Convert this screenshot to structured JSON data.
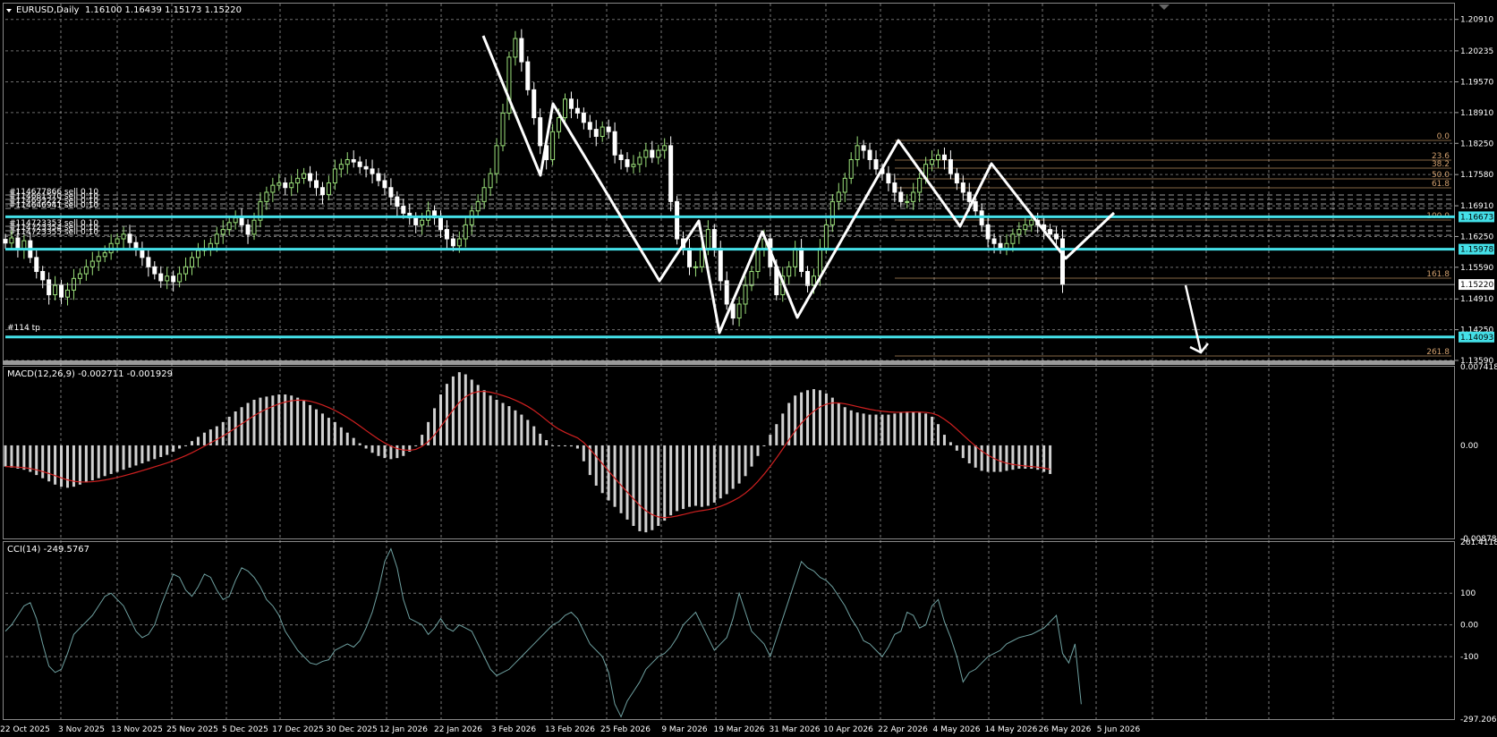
{
  "colors": {
    "background": "#000000",
    "grid": "#c8c8c8",
    "bull_candle": "#9be07a",
    "bear_candle": "#ffffff",
    "cyan_line": "#44e0e8",
    "fib_line": "#d2a06e",
    "macd_hist": "#d0d0d0",
    "macd_signal": "#d02020",
    "cci_line": "#6ea0a0",
    "zigzag": "#ffffff"
  },
  "main_panel": {
    "symbol_label": "EURUSD,Daily",
    "ohlc_label": "1.16100 1.16439 1.15173 1.15220",
    "price_ticks": [
      "1.20910",
      "1.20235",
      "1.19570",
      "1.18910",
      "1.18250",
      "1.17580",
      "1.16910",
      "1.16250",
      "1.15590",
      "1.14910",
      "1.14250",
      "1.13590"
    ],
    "marked_prices": {
      "upper_cyan": "1.16673",
      "middle_cyan": "1.15978",
      "current": "1.15220",
      "lower_cyan": "1.14093"
    },
    "order_labels": [
      "#114677866 sell 0.10",
      "#114681570 sell 0.10",
      "#114693222 sell 0.10",
      "#114646941 sell 0.10",
      "#114723353 sell 0.10",
      "#114723354 sell 0.10",
      "#114723355 sell 0.10"
    ],
    "tp_label": "#114 tp",
    "fib_levels": [
      "0.0",
      "23.6",
      "38.2",
      "50.0",
      "61.8",
      "100.0",
      "161.8",
      "261.8"
    ]
  },
  "macd_panel": {
    "label": "MACD(12,26,9) -0.002711 -0.001929",
    "ticks": [
      "0.007418",
      "0.00",
      "-0.00878"
    ]
  },
  "cci_panel": {
    "label": "CCI(14) -249.5767",
    "ticks": [
      "261.4118",
      "100",
      "0.00",
      "-100",
      "-297.206"
    ]
  },
  "x_labels": [
    "22 Oct 2025",
    "3 Nov 2025",
    "13 Nov 2025",
    "25 Nov 2025",
    "5 Dec 2025",
    "17 Dec 2025",
    "30 Dec 2025",
    "12 Jan 2026",
    "22 Jan 2026",
    "3 Feb 2026",
    "13 Feb 2026",
    "25 Feb 2026",
    "9 Mar 2026",
    "19 Mar 2026",
    "31 Mar 2026",
    "10 Apr 2026",
    "22 Apr 2026",
    "4 May 2026",
    "14 May 2026",
    "26 May 2026",
    "5 Jun 2026"
  ],
  "chart_data": [
    {
      "type": "candlestick",
      "title": "EURUSD,Daily",
      "ylim": [
        1.1359,
        1.2125
      ],
      "close": [
        1.1611,
        1.1622,
        1.1598,
        1.1616,
        1.158,
        1.155,
        1.1532,
        1.15,
        1.152,
        1.1495,
        1.151,
        1.1535,
        1.1545,
        1.156,
        1.1572,
        1.1582,
        1.159,
        1.161,
        1.162,
        1.163,
        1.1612,
        1.1598,
        1.158,
        1.156,
        1.1545,
        1.153,
        1.154,
        1.1528,
        1.1545,
        1.156,
        1.158,
        1.1595,
        1.1598,
        1.161,
        1.163,
        1.164,
        1.1655,
        1.1665,
        1.165,
        1.163,
        1.166,
        1.17,
        1.172,
        1.1735,
        1.174,
        1.173,
        1.174,
        1.175,
        1.176,
        1.1745,
        1.173,
        1.1715,
        1.174,
        1.177,
        1.178,
        1.179,
        1.1785,
        1.1775,
        1.177,
        1.176,
        1.1745,
        1.173,
        1.171,
        1.169,
        1.1675,
        1.1665,
        1.165,
        1.166,
        1.168,
        1.1665,
        1.164,
        1.162,
        1.1605,
        1.162,
        1.165,
        1.168,
        1.17,
        1.173,
        1.176,
        1.182,
        1.189,
        1.201,
        1.205,
        1.2,
        1.194,
        1.188,
        1.182,
        1.179,
        1.185,
        1.188,
        1.192,
        1.19,
        1.189,
        1.187,
        1.1855,
        1.184,
        1.186,
        1.185,
        1.18,
        1.179,
        1.1775,
        1.178,
        1.1795,
        1.181,
        1.1795,
        1.181,
        1.182,
        1.17,
        1.162,
        1.16,
        1.156,
        1.156,
        1.16,
        1.164,
        1.16,
        1.153,
        1.148,
        1.145,
        1.148,
        1.152,
        1.155,
        1.16,
        1.162,
        1.156,
        1.15,
        1.154,
        1.156,
        1.16,
        1.155,
        1.152,
        1.154,
        1.16,
        1.165,
        1.17,
        1.172,
        1.175,
        1.179,
        1.182,
        1.181,
        1.179,
        1.177,
        1.176,
        1.174,
        1.172,
        1.17,
        1.17,
        1.172,
        1.175,
        1.178,
        1.179,
        1.18,
        1.179,
        1.176,
        1.174,
        1.172,
        1.17,
        1.168,
        1.165,
        1.162,
        1.161,
        1.16,
        1.161,
        1.163,
        1.164,
        1.165,
        1.166,
        1.165,
        1.164,
        1.163,
        1.162,
        1.1522
      ]
    },
    {
      "type": "bar",
      "title": "MACD(12,26,9)",
      "ylim": [
        -0.00878,
        0.007418
      ],
      "values": [
        -0.002,
        -0.0021,
        -0.0022,
        -0.0023,
        -0.0025,
        -0.0028,
        -0.0031,
        -0.0034,
        -0.0037,
        -0.0039,
        -0.004,
        -0.0039,
        -0.0037,
        -0.0035,
        -0.0033,
        -0.0031,
        -0.0029,
        -0.0027,
        -0.0025,
        -0.0023,
        -0.0021,
        -0.0019,
        -0.0017,
        -0.0015,
        -0.0013,
        -0.0011,
        -0.0009,
        -0.0006,
        -0.0003,
        0.0,
        0.0004,
        0.0008,
        0.0012,
        0.0015,
        0.0018,
        0.0022,
        0.0027,
        0.0032,
        0.0036,
        0.004,
        0.0043,
        0.0045,
        0.0046,
        0.0047,
        0.0048,
        0.0048,
        0.0047,
        0.0045,
        0.0042,
        0.0038,
        0.0034,
        0.003,
        0.0026,
        0.0022,
        0.0017,
        0.0012,
        0.0007,
        0.0002,
        -0.0003,
        -0.0007,
        -0.001,
        -0.0012,
        -0.0013,
        -0.0012,
        -0.001,
        -0.0006,
        0.0,
        0.001,
        0.0022,
        0.0035,
        0.0048,
        0.0058,
        0.0065,
        0.0069,
        0.0067,
        0.0062,
        0.0057,
        0.0052,
        0.0047,
        0.0043,
        0.004,
        0.0037,
        0.0033,
        0.0029,
        0.0024,
        0.0018,
        0.0011,
        0.0005,
        0.0,
        0.0,
        0.0,
        -0.0001,
        -0.0003,
        -0.0015,
        -0.0028,
        -0.0038,
        -0.0045,
        -0.0052,
        -0.0058,
        -0.0064,
        -0.007,
        -0.0076,
        -0.0081,
        -0.0082,
        -0.008,
        -0.0076,
        -0.0071,
        -0.0066,
        -0.0062,
        -0.006,
        -0.0058,
        -0.0057,
        -0.0058,
        -0.0057,
        -0.0054,
        -0.005,
        -0.0046,
        -0.0041,
        -0.0036,
        -0.0029,
        -0.002,
        -0.001,
        0.0,
        0.001,
        0.002,
        0.003,
        0.004,
        0.0047,
        0.005,
        0.0052,
        0.0053,
        0.0052,
        0.0049,
        0.0045,
        0.004,
        0.0036,
        0.0033,
        0.0031,
        0.003,
        0.0029,
        0.0029,
        0.0029,
        0.0029,
        0.003,
        0.0031,
        0.0032,
        0.0032,
        0.0031,
        0.003,
        0.0027,
        0.002,
        0.001,
        0.0003,
        -0.0005,
        -0.0012,
        -0.0017,
        -0.0021,
        -0.0024,
        -0.0025,
        -0.0025,
        -0.0025,
        -0.0024,
        -0.0023,
        -0.0022,
        -0.0022,
        -0.0022,
        -0.0023,
        -0.0025,
        -0.0027
      ]
    },
    {
      "type": "line",
      "title": "CCI(14)",
      "ylim": [
        -297.206,
        261.4118
      ],
      "values": [
        -20,
        0,
        30,
        60,
        70,
        20,
        -60,
        -130,
        -150,
        -140,
        -90,
        -30,
        -10,
        10,
        30,
        60,
        90,
        100,
        80,
        60,
        20,
        -20,
        -40,
        -30,
        0,
        60,
        110,
        160,
        150,
        110,
        90,
        120,
        160,
        150,
        110,
        80,
        90,
        140,
        180,
        170,
        150,
        120,
        80,
        60,
        30,
        -20,
        -50,
        -80,
        -100,
        -120,
        -125,
        -115,
        -110,
        -80,
        -70,
        -60,
        -70,
        -50,
        -10,
        40,
        110,
        200,
        240,
        180,
        80,
        20,
        10,
        0,
        -30,
        -10,
        20,
        -10,
        -20,
        0,
        -10,
        -20,
        -60,
        -100,
        -140,
        -160,
        -150,
        -140,
        -120,
        -100,
        -80,
        -60,
        -40,
        -20,
        0,
        10,
        30,
        40,
        20,
        -20,
        -60,
        -80,
        -100,
        -150,
        -250,
        -290,
        -240,
        -210,
        -180,
        -140,
        -120,
        -100,
        -90,
        -70,
        -40,
        0,
        20,
        40,
        0,
        -40,
        -80,
        -60,
        -40,
        20,
        100,
        40,
        -20,
        -40,
        -60,
        -100,
        -40,
        20,
        80,
        140,
        200,
        180,
        170,
        150,
        140,
        120,
        90,
        60,
        20,
        -10,
        -50,
        -60,
        -80,
        -100,
        -70,
        -30,
        -20,
        40,
        30,
        -10,
        0,
        60,
        80,
        10,
        -40,
        -100,
        -180,
        -150,
        -140,
        -120,
        -100,
        -90,
        -80,
        -60,
        -50,
        -40,
        -35,
        -30,
        -20,
        -10,
        10,
        30,
        -90,
        -120,
        -60,
        -250
      ]
    }
  ]
}
